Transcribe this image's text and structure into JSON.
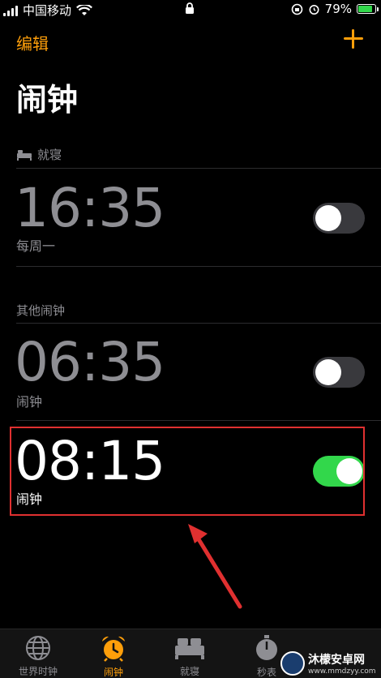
{
  "status_bar": {
    "carrier": "中国移动",
    "battery": "79%",
    "battery_level": 0.79
  },
  "nav": {
    "edit_label": "编辑",
    "add_icon": "plus-icon"
  },
  "title": "闹钟",
  "sections": {
    "bedtime": {
      "label": "就寝",
      "icon": "bed-icon"
    },
    "other": {
      "label": "其他闹钟"
    }
  },
  "alarms": [
    {
      "time": "16:35",
      "label": "每周一",
      "enabled": false
    },
    {
      "time": "06:35",
      "label": "闹钟",
      "enabled": false
    },
    {
      "time": "08:15",
      "label": "闹钟",
      "enabled": true
    }
  ],
  "tab_bar": {
    "tabs": [
      {
        "label": "世界时钟",
        "icon": "globe-icon",
        "active": false
      },
      {
        "label": "闹钟",
        "icon": "alarm-clock-icon",
        "active": true
      },
      {
        "label": "就寝",
        "icon": "bed-icon",
        "active": false
      },
      {
        "label": "秒表",
        "icon": "stopwatch-icon",
        "active": false
      }
    ]
  },
  "watermark": {
    "title": "沐檬安卓网",
    "url": "www.mmdzyy.com"
  },
  "colors": {
    "accent": "#ff9f0a",
    "toggle_on": "#32d74b",
    "highlight": "#e03030"
  }
}
